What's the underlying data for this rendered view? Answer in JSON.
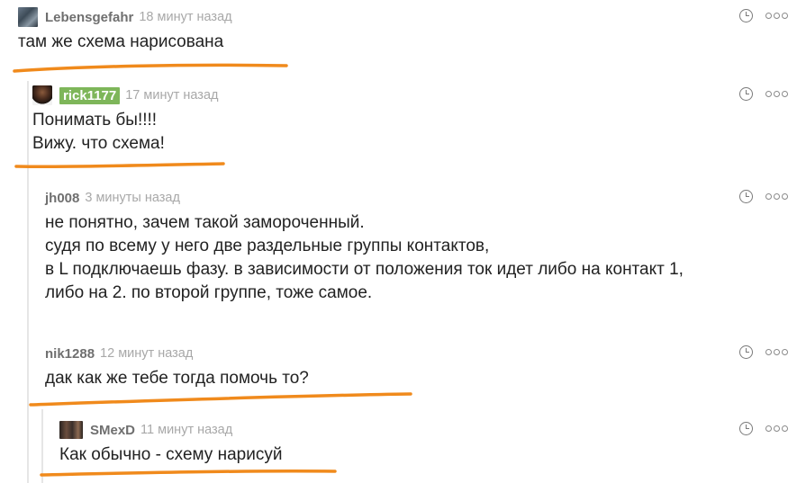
{
  "comments": [
    {
      "author": "Lebensgefahr",
      "time": "18 минут назад",
      "lines": [
        "там же схема нарисована"
      ]
    },
    {
      "author": "rick1177",
      "time": "17 минут назад",
      "lines": [
        "Понимать бы!!!!",
        "Вижу. что схема!"
      ]
    },
    {
      "author": "jh008",
      "time": "3 минуты назад",
      "lines": [
        "не понятно, зачем такой замороченный.",
        "судя по всему у него две раздельные группы контактов,",
        "в L подключаешь фазу. в зависимости от положения ток идет либо на контакт 1,",
        "либо на 2.  по второй группе, тоже самое."
      ]
    },
    {
      "author": "nik1288",
      "time": "12 минут назад",
      "lines": [
        "дак как же тебе тогда помочь то?"
      ]
    },
    {
      "author": "SMexD",
      "time": "11 минут назад",
      "lines": [
        "Как обычно - схему нарисуй"
      ]
    }
  ],
  "icons": {
    "time": "clock-icon",
    "more": "more-dots-icon",
    "avatar": "avatar-image"
  },
  "colors": {
    "author_highlight_bg": "#7eb65a",
    "underline_ink": "#f08a1c",
    "meta_text": "#a8a8a8"
  }
}
